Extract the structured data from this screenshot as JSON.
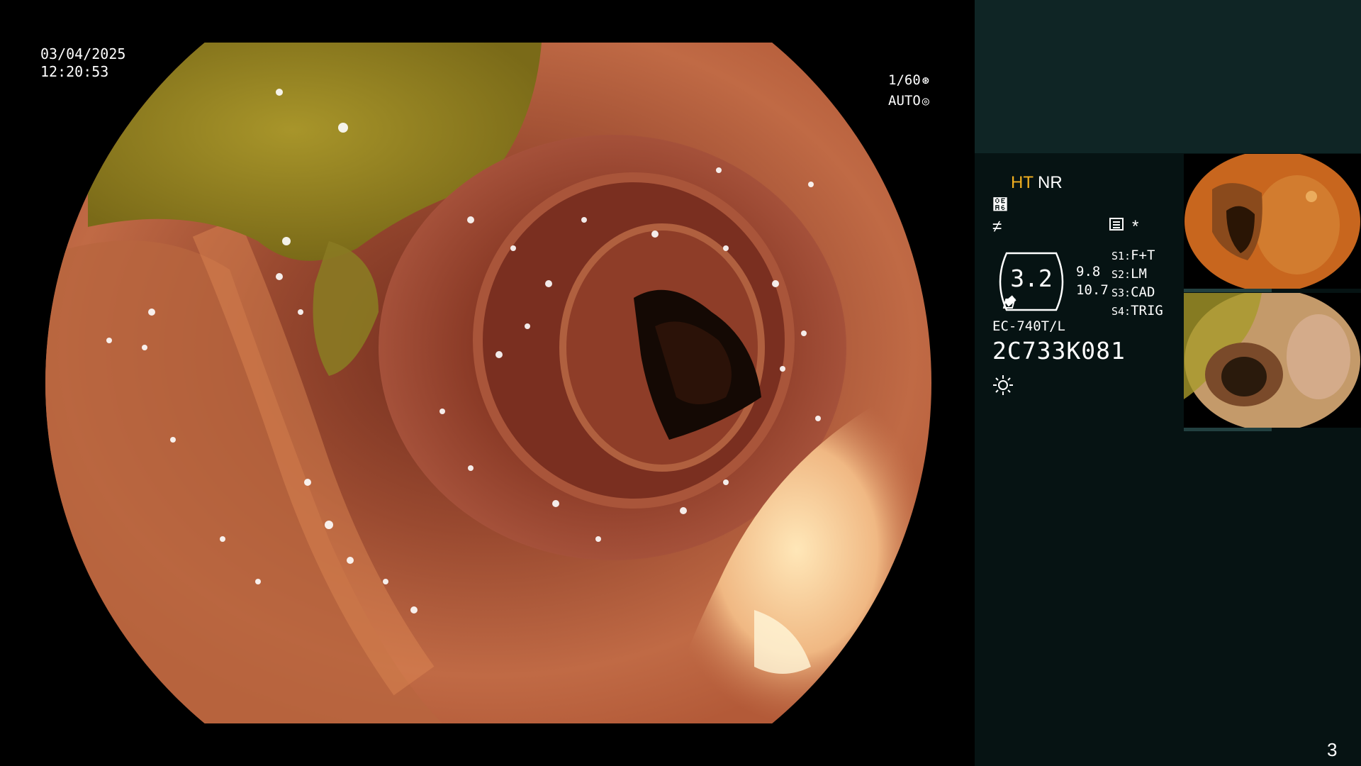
{
  "overlay": {
    "date": "03/04/2025",
    "time": "12:20:53",
    "shutter": "1/60",
    "exposure": "AUTO"
  },
  "panel": {
    "mode_ht": "HT",
    "mode_nr": "NR",
    "symbol_1": "຦",
    "symbol_2": "≠",
    "star": "*",
    "gauge_value": "3.2",
    "value_top": "9.8",
    "value_bottom": "10.7",
    "presets": [
      {
        "key": "S1:",
        "label": "F+T"
      },
      {
        "key": "S2:",
        "label": "LM"
      },
      {
        "key": "S3:",
        "label": "CAD"
      },
      {
        "key": "S4:",
        "label": "TRIG"
      }
    ],
    "model": "EC-740T/L",
    "serial": "2C733K081"
  },
  "page_number": "3",
  "colors": {
    "panel_top": "#0f2525",
    "panel_body": "#061313",
    "accent_ht": "#f2b020"
  },
  "icons": {
    "shutter_icon": "aperture-icon",
    "exposure_icon": "target-icon",
    "light_icon": "sun-icon",
    "menu_icon": "list-icon"
  }
}
